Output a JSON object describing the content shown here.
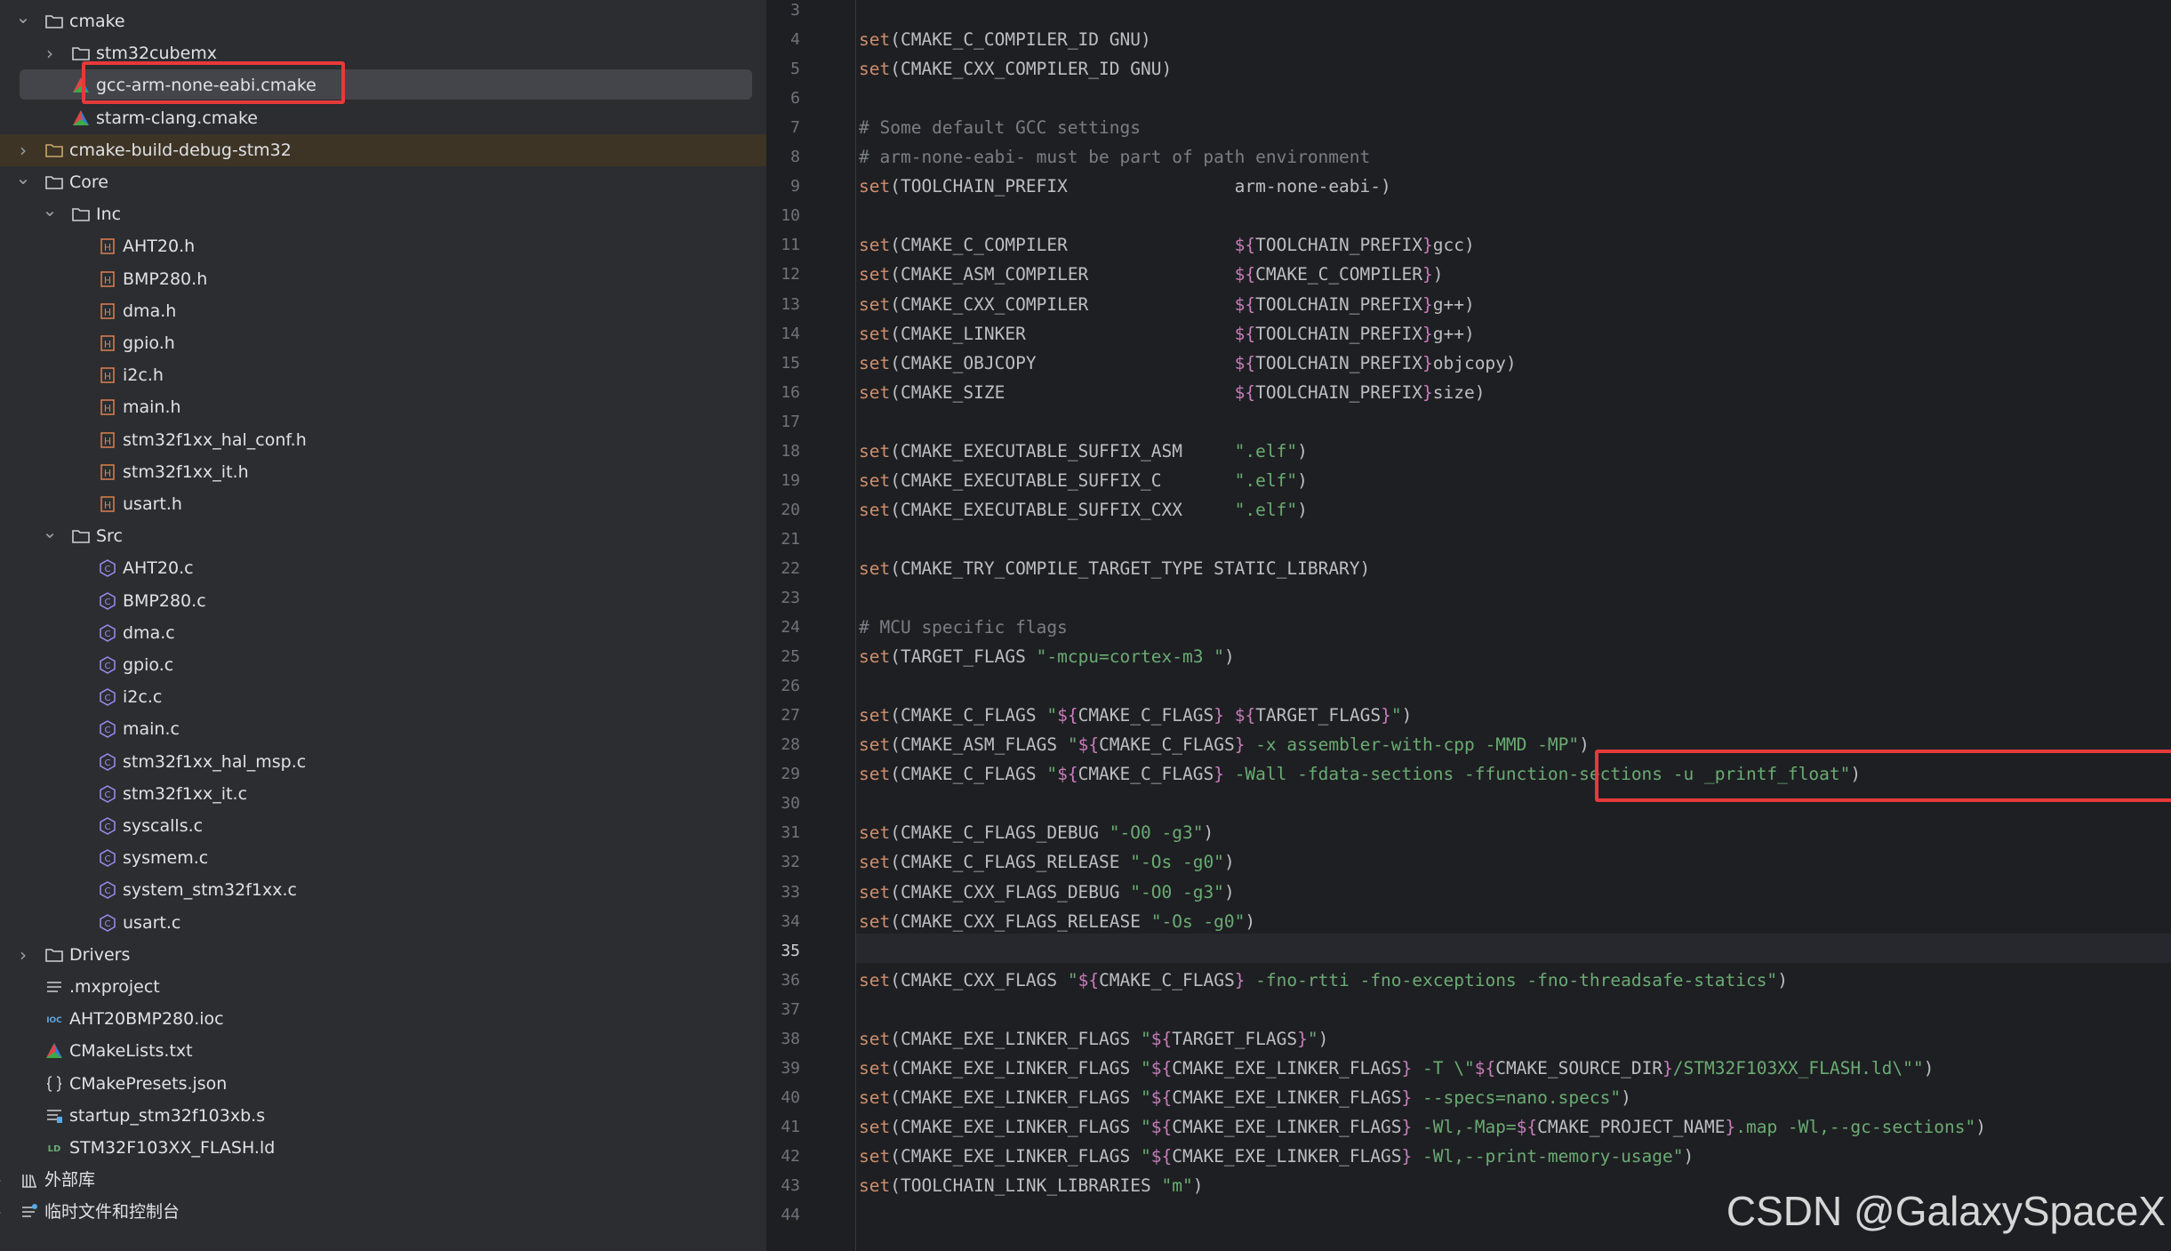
{
  "tree": {
    "rows": [
      {
        "label": "cmake",
        "icon": "folder-icon",
        "chevron": "expanded"
      },
      {
        "label": "stm32cubemx",
        "icon": "folder-icon",
        "chevron": "collapsed"
      },
      {
        "label": "gcc-arm-none-eabi.cmake",
        "icon": "cmake-file-icon",
        "chevron": "none",
        "selected": true
      },
      {
        "label": "starm-clang.cmake",
        "icon": "cmake-file-icon",
        "chevron": "none"
      },
      {
        "label": "cmake-build-debug-stm32",
        "icon": "folder-excluded-icon",
        "chevron": "collapsed",
        "excluded": true
      },
      {
        "label": "Core",
        "icon": "folder-icon",
        "chevron": "expanded"
      },
      {
        "label": "Inc",
        "icon": "folder-icon",
        "chevron": "expanded"
      },
      {
        "label": "AHT20.h",
        "icon": "header-file-icon",
        "chevron": "none"
      },
      {
        "label": "BMP280.h",
        "icon": "header-file-icon",
        "chevron": "none"
      },
      {
        "label": "dma.h",
        "icon": "header-file-icon",
        "chevron": "none"
      },
      {
        "label": "gpio.h",
        "icon": "header-file-icon",
        "chevron": "none"
      },
      {
        "label": "i2c.h",
        "icon": "header-file-icon",
        "chevron": "none"
      },
      {
        "label": "main.h",
        "icon": "header-file-icon",
        "chevron": "none"
      },
      {
        "label": "stm32f1xx_hal_conf.h",
        "icon": "header-file-icon",
        "chevron": "none"
      },
      {
        "label": "stm32f1xx_it.h",
        "icon": "header-file-icon",
        "chevron": "none"
      },
      {
        "label": "usart.h",
        "icon": "header-file-icon",
        "chevron": "none"
      },
      {
        "label": "Src",
        "icon": "folder-icon",
        "chevron": "expanded"
      },
      {
        "label": "AHT20.c",
        "icon": "c-file-icon",
        "chevron": "none"
      },
      {
        "label": "BMP280.c",
        "icon": "c-file-icon",
        "chevron": "none"
      },
      {
        "label": "dma.c",
        "icon": "c-file-icon",
        "chevron": "none"
      },
      {
        "label": "gpio.c",
        "icon": "c-file-icon",
        "chevron": "none"
      },
      {
        "label": "i2c.c",
        "icon": "c-file-icon",
        "chevron": "none"
      },
      {
        "label": "main.c",
        "icon": "c-file-icon",
        "chevron": "none"
      },
      {
        "label": "stm32f1xx_hal_msp.c",
        "icon": "c-file-icon",
        "chevron": "none"
      },
      {
        "label": "stm32f1xx_it.c",
        "icon": "c-file-icon",
        "chevron": "none"
      },
      {
        "label": "syscalls.c",
        "icon": "c-file-icon",
        "chevron": "none"
      },
      {
        "label": "sysmem.c",
        "icon": "c-file-icon",
        "chevron": "none"
      },
      {
        "label": "system_stm32f1xx.c",
        "icon": "c-file-icon",
        "chevron": "none"
      },
      {
        "label": "usart.c",
        "icon": "c-file-icon",
        "chevron": "none"
      },
      {
        "label": "Drivers",
        "icon": "folder-icon",
        "chevron": "collapsed"
      },
      {
        "label": ".mxproject",
        "icon": "text-file-icon",
        "chevron": "none"
      },
      {
        "label": "AHT20BMP280.ioc",
        "icon": "ioc-file-icon",
        "chevron": "none"
      },
      {
        "label": "CMakeLists.txt",
        "icon": "cmake-file-icon",
        "chevron": "none"
      },
      {
        "label": "CMakePresets.json",
        "icon": "json-file-icon",
        "chevron": "none"
      },
      {
        "label": "startup_stm32f103xb.s",
        "icon": "asm-file-icon",
        "chevron": "none"
      },
      {
        "label": "STM32F103XX_FLASH.ld",
        "icon": "ld-file-icon",
        "chevron": "none"
      },
      {
        "label": "外部库",
        "icon": "library-icon",
        "chevron": "collapsed"
      },
      {
        "label": "临时文件和控制台",
        "icon": "scratches-icon",
        "chevron": "collapsed"
      }
    ]
  },
  "editor": {
    "current_line": "35",
    "lines": [
      {
        "n": "3",
        "t": []
      },
      {
        "n": "4",
        "t": [
          [
            "kw",
            "set"
          ],
          [
            "tx",
            "(CMAKE_C_COMPILER_ID GNU)"
          ]
        ]
      },
      {
        "n": "5",
        "t": [
          [
            "kw",
            "set"
          ],
          [
            "tx",
            "(CMAKE_CXX_COMPILER_ID GNU)"
          ]
        ]
      },
      {
        "n": "6",
        "t": []
      },
      {
        "n": "7",
        "t": [
          [
            "cm",
            "# Some default GCC settings"
          ]
        ]
      },
      {
        "n": "8",
        "t": [
          [
            "cm",
            "# arm-none-eabi- must be part of path environment"
          ]
        ]
      },
      {
        "n": "9",
        "t": [
          [
            "kw",
            "set"
          ],
          [
            "tx",
            "(TOOLCHAIN_PREFIX                arm-none-eabi-)"
          ]
        ]
      },
      {
        "n": "10",
        "t": []
      },
      {
        "n": "11",
        "t": [
          [
            "kw",
            "set"
          ],
          [
            "tx",
            "(CMAKE_C_COMPILER                "
          ],
          [
            "vr",
            "${"
          ],
          [
            "tx",
            "TOOLCHAIN_PREFIX"
          ],
          [
            "vr",
            "}"
          ],
          [
            "tx",
            "gcc)"
          ]
        ]
      },
      {
        "n": "12",
        "t": [
          [
            "kw",
            "set"
          ],
          [
            "tx",
            "(CMAKE_ASM_COMPILER              "
          ],
          [
            "vr",
            "${"
          ],
          [
            "tx",
            "CMAKE_C_COMPILER"
          ],
          [
            "vr",
            "}"
          ],
          [
            "tx",
            ")"
          ]
        ]
      },
      {
        "n": "13",
        "t": [
          [
            "kw",
            "set"
          ],
          [
            "tx",
            "(CMAKE_CXX_COMPILER              "
          ],
          [
            "vr",
            "${"
          ],
          [
            "tx",
            "TOOLCHAIN_PREFIX"
          ],
          [
            "vr",
            "}"
          ],
          [
            "tx",
            "g++)"
          ]
        ]
      },
      {
        "n": "14",
        "t": [
          [
            "kw",
            "set"
          ],
          [
            "tx",
            "(CMAKE_LINKER                    "
          ],
          [
            "vr",
            "${"
          ],
          [
            "tx",
            "TOOLCHAIN_PREFIX"
          ],
          [
            "vr",
            "}"
          ],
          [
            "tx",
            "g++)"
          ]
        ]
      },
      {
        "n": "15",
        "t": [
          [
            "kw",
            "set"
          ],
          [
            "tx",
            "(CMAKE_OBJCOPY                   "
          ],
          [
            "vr",
            "${"
          ],
          [
            "tx",
            "TOOLCHAIN_PREFIX"
          ],
          [
            "vr",
            "}"
          ],
          [
            "tx",
            "objcopy)"
          ]
        ]
      },
      {
        "n": "16",
        "t": [
          [
            "kw",
            "set"
          ],
          [
            "tx",
            "(CMAKE_SIZE                      "
          ],
          [
            "vr",
            "${"
          ],
          [
            "tx",
            "TOOLCHAIN_PREFIX"
          ],
          [
            "vr",
            "}"
          ],
          [
            "tx",
            "size)"
          ]
        ]
      },
      {
        "n": "17",
        "t": []
      },
      {
        "n": "18",
        "t": [
          [
            "kw",
            "set"
          ],
          [
            "tx",
            "(CMAKE_EXECUTABLE_SUFFIX_ASM     "
          ],
          [
            "sn",
            "\".elf\""
          ],
          [
            "tx",
            ")"
          ]
        ]
      },
      {
        "n": "19",
        "t": [
          [
            "kw",
            "set"
          ],
          [
            "tx",
            "(CMAKE_EXECUTABLE_SUFFIX_C       "
          ],
          [
            "sn",
            "\".elf\""
          ],
          [
            "tx",
            ")"
          ]
        ]
      },
      {
        "n": "20",
        "t": [
          [
            "kw",
            "set"
          ],
          [
            "tx",
            "(CMAKE_EXECUTABLE_SUFFIX_CXX     "
          ],
          [
            "sn",
            "\".elf\""
          ],
          [
            "tx",
            ")"
          ]
        ]
      },
      {
        "n": "21",
        "t": []
      },
      {
        "n": "22",
        "t": [
          [
            "kw",
            "set"
          ],
          [
            "tx",
            "(CMAKE_TRY_COMPILE_TARGET_TYPE STATIC_LIBRARY)"
          ]
        ]
      },
      {
        "n": "23",
        "t": []
      },
      {
        "n": "24",
        "t": [
          [
            "cm",
            "# MCU specific flags"
          ]
        ]
      },
      {
        "n": "25",
        "t": [
          [
            "kw",
            "set"
          ],
          [
            "tx",
            "(TARGET_FLAGS "
          ],
          [
            "sn",
            "\"-mcpu=cortex-m3 \""
          ],
          [
            "tx",
            ")"
          ]
        ]
      },
      {
        "n": "26",
        "t": []
      },
      {
        "n": "27",
        "t": [
          [
            "kw",
            "set"
          ],
          [
            "tx",
            "(CMAKE_C_FLAGS "
          ],
          [
            "sn",
            "\""
          ],
          [
            "vr",
            "${"
          ],
          [
            "tx",
            "CMAKE_C_FLAGS"
          ],
          [
            "vr",
            "}"
          ],
          [
            "sn",
            " "
          ],
          [
            "vr",
            "${"
          ],
          [
            "tx",
            "TARGET_FLAGS"
          ],
          [
            "vr",
            "}"
          ],
          [
            "sn",
            "\""
          ],
          [
            "tx",
            ")"
          ]
        ]
      },
      {
        "n": "28",
        "t": [
          [
            "kw",
            "set"
          ],
          [
            "tx",
            "(CMAKE_ASM_FLAGS "
          ],
          [
            "sn",
            "\""
          ],
          [
            "vr",
            "${"
          ],
          [
            "tx",
            "CMAKE_C_FLAGS"
          ],
          [
            "vr",
            "}"
          ],
          [
            "sn",
            " -x assembler-with-cpp -MMD -MP\""
          ],
          [
            "tx",
            ")"
          ]
        ]
      },
      {
        "n": "29",
        "t": [
          [
            "kw",
            "set"
          ],
          [
            "tx",
            "(CMAKE_C_FLAGS "
          ],
          [
            "sn",
            "\""
          ],
          [
            "vr",
            "${"
          ],
          [
            "tx",
            "CMAKE_C_FLAGS"
          ],
          [
            "vr",
            "}"
          ],
          [
            "sn",
            " -Wall -fdata-sections -ffunction-sections -u _printf_float\""
          ],
          [
            "tx",
            ")"
          ]
        ]
      },
      {
        "n": "30",
        "t": []
      },
      {
        "n": "31",
        "t": [
          [
            "kw",
            "set"
          ],
          [
            "tx",
            "(CMAKE_C_FLAGS_DEBUG "
          ],
          [
            "sn",
            "\"-O0 -g3\""
          ],
          [
            "tx",
            ")"
          ]
        ]
      },
      {
        "n": "32",
        "t": [
          [
            "kw",
            "set"
          ],
          [
            "tx",
            "(CMAKE_C_FLAGS_RELEASE "
          ],
          [
            "sn",
            "\"-Os -g0\""
          ],
          [
            "tx",
            ")"
          ]
        ]
      },
      {
        "n": "33",
        "t": [
          [
            "kw",
            "set"
          ],
          [
            "tx",
            "(CMAKE_CXX_FLAGS_DEBUG "
          ],
          [
            "sn",
            "\"-O0 -g3\""
          ],
          [
            "tx",
            ")"
          ]
        ]
      },
      {
        "n": "34",
        "t": [
          [
            "kw",
            "set"
          ],
          [
            "tx",
            "(CMAKE_CXX_FLAGS_RELEASE "
          ],
          [
            "sn",
            "\"-Os -g0\""
          ],
          [
            "tx",
            ")"
          ]
        ]
      },
      {
        "n": "35",
        "t": []
      },
      {
        "n": "36",
        "t": [
          [
            "kw",
            "set"
          ],
          [
            "tx",
            "(CMAKE_CXX_FLAGS "
          ],
          [
            "sn",
            "\""
          ],
          [
            "vr",
            "${"
          ],
          [
            "tx",
            "CMAKE_C_FLAGS"
          ],
          [
            "vr",
            "}"
          ],
          [
            "sn",
            " -fno-rtti -fno-exceptions -fno-threadsafe-statics\""
          ],
          [
            "tx",
            ")"
          ]
        ]
      },
      {
        "n": "37",
        "t": []
      },
      {
        "n": "38",
        "t": [
          [
            "kw",
            "set"
          ],
          [
            "tx",
            "(CMAKE_EXE_LINKER_FLAGS "
          ],
          [
            "sn",
            "\""
          ],
          [
            "vr",
            "${"
          ],
          [
            "tx",
            "TARGET_FLAGS"
          ],
          [
            "vr",
            "}"
          ],
          [
            "sn",
            "\""
          ],
          [
            "tx",
            ")"
          ]
        ]
      },
      {
        "n": "39",
        "t": [
          [
            "kw",
            "set"
          ],
          [
            "tx",
            "(CMAKE_EXE_LINKER_FLAGS "
          ],
          [
            "sn",
            "\""
          ],
          [
            "vr",
            "${"
          ],
          [
            "tx",
            "CMAKE_EXE_LINKER_FLAGS"
          ],
          [
            "vr",
            "}"
          ],
          [
            "sn",
            " -T \\\""
          ],
          [
            "vr",
            "${"
          ],
          [
            "tx",
            "CMAKE_SOURCE_DIR"
          ],
          [
            "vr",
            "}"
          ],
          [
            "sn",
            "/STM32F103XX_FLASH.ld\\\"\""
          ],
          [
            "tx",
            ")"
          ]
        ]
      },
      {
        "n": "40",
        "t": [
          [
            "kw",
            "set"
          ],
          [
            "tx",
            "(CMAKE_EXE_LINKER_FLAGS "
          ],
          [
            "sn",
            "\""
          ],
          [
            "vr",
            "${"
          ],
          [
            "tx",
            "CMAKE_EXE_LINKER_FLAGS"
          ],
          [
            "vr",
            "}"
          ],
          [
            "sn",
            " --specs=nano.specs\""
          ],
          [
            "tx",
            ")"
          ]
        ]
      },
      {
        "n": "41",
        "t": [
          [
            "kw",
            "set"
          ],
          [
            "tx",
            "(CMAKE_EXE_LINKER_FLAGS "
          ],
          [
            "sn",
            "\""
          ],
          [
            "vr",
            "${"
          ],
          [
            "tx",
            "CMAKE_EXE_LINKER_FLAGS"
          ],
          [
            "vr",
            "}"
          ],
          [
            "sn",
            " -Wl,-Map="
          ],
          [
            "vr",
            "${"
          ],
          [
            "tx",
            "CMAKE_PROJECT_NAME"
          ],
          [
            "vr",
            "}"
          ],
          [
            "sn",
            ".map -Wl,--gc-sections\""
          ],
          [
            "tx",
            ")"
          ]
        ]
      },
      {
        "n": "42",
        "t": [
          [
            "kw",
            "set"
          ],
          [
            "tx",
            "(CMAKE_EXE_LINKER_FLAGS "
          ],
          [
            "sn",
            "\""
          ],
          [
            "vr",
            "${"
          ],
          [
            "tx",
            "CMAKE_EXE_LINKER_FLAGS"
          ],
          [
            "vr",
            "}"
          ],
          [
            "sn",
            " -Wl,--print-memory-usage\""
          ],
          [
            "tx",
            ")"
          ]
        ]
      },
      {
        "n": "43",
        "t": [
          [
            "kw",
            "set"
          ],
          [
            "tx",
            "(TOOLCHAIN_LINK_LIBRARIES "
          ],
          [
            "sn",
            "\"m\""
          ],
          [
            "tx",
            ")"
          ]
        ]
      },
      {
        "n": "44",
        "t": []
      }
    ]
  },
  "watermark": "CSDN @GalaxySpaceX"
}
